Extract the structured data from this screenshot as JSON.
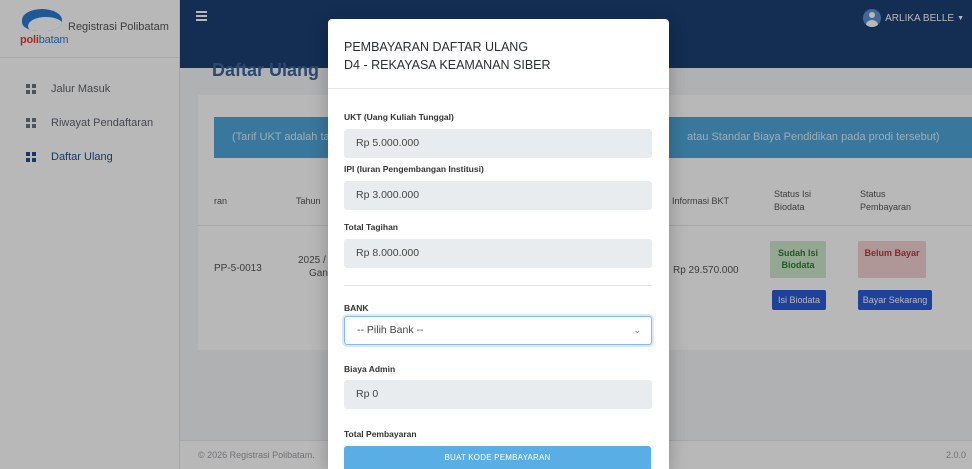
{
  "app": {
    "brand_text": "Registrasi Polibatam",
    "logo_word_a": "poli",
    "logo_word_b": "batam"
  },
  "sidebar": {
    "items": [
      {
        "label": "Jalur Masuk",
        "active": false
      },
      {
        "label": "Riwayat Pendaftaran",
        "active": false
      },
      {
        "label": "Daftar Ulang",
        "active": true
      }
    ]
  },
  "topbar": {
    "user_name": "ARLIKA BELLE"
  },
  "page": {
    "title": "Daftar Ulang",
    "info_left": "(Tarif UKT adalah ta",
    "info_right": "atau Standar Biaya Pendidikan pada prodi tersebut)"
  },
  "table": {
    "headers": [
      "ran",
      "Tahun",
      "Informasi BKT",
      "Status Isi Biodata",
      "Status Pembayaran"
    ],
    "row": {
      "code": "PP-5-0013",
      "year_line1": "2025 /",
      "year_line2": "Gan",
      "bkt": "Rp 29.570.000",
      "biodata_status": "Sudah Isi Biodata",
      "payment_status": "Belum Bayar",
      "biodata_button": "Isi Biodata",
      "pay_button": "Bayar Sekarang"
    }
  },
  "footer": {
    "copyright": "© 2026 Registrasi Polibatam.",
    "version": "2.0.0"
  },
  "modal": {
    "title_line1": "PEMBAYARAN DAFTAR ULANG",
    "title_line2": "D4 - REKAYASA KEAMANAN SIBER",
    "ukt_label": "UKT (Uang Kuliah Tunggal)",
    "ukt_value": "Rp 5.000.000",
    "ipi_label": "IPI (Iuran Pengembangan Institusi)",
    "ipi_value": "Rp 3.000.000",
    "total_label": "Total Tagihan",
    "total_value": "Rp 8.000.000",
    "bank_label": "BANK",
    "bank_selected": "-- Pilih Bank --",
    "admin_label": "Biaya Admin",
    "admin_value": "Rp 0",
    "total_payment_label": "Total Pembayaran",
    "generate_button": "BUAT KODE PEMBAYARAN"
  },
  "colors": {
    "navy": "#1b3f73",
    "info": "#4fa6d8",
    "primary": "#2a5bd7",
    "generate": "#58aee5"
  }
}
